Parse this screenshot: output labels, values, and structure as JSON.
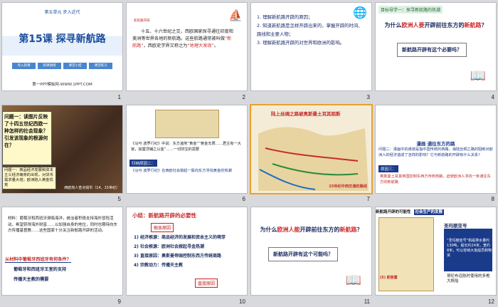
{
  "slides": {
    "s1": {
      "number": "1",
      "unit": "第五单元  步入近代",
      "title": "第15课 探寻新航路",
      "buttons": [
        "导入新课",
        "新课讲授",
        "课堂小结",
        "课堂练习"
      ],
      "footer": "第一PPT模板网-WWW.1PPT.COM"
    },
    "s2": {
      "number": "2",
      "tag": "新航路开辟",
      "body_a": "十五、十六世纪之交，西欧国家探寻通往印度和美洲等世界各地的新航路。这些航路通常被叫做",
      "body_red1": "“新航路”",
      "body_b": "，西欧史学界又称之为",
      "body_red2": "“地理大发现”",
      "body_c": "。"
    },
    "s3": {
      "number": "3",
      "items": [
        "1. 理解新航路开辟的原因；",
        "2. 知道新航路是怎样开辟出来的，掌握开辟的时间、路线和主要人物；",
        "3. 理解新航路开辟的对世界和欧洲的影响。"
      ]
    },
    "s4": {
      "number": "4",
      "goal": "目标导学一：探寻新航路的热潮",
      "q_a": "为什么",
      "q_red": "欧洲人要",
      "q_b": "开辟前往东方的",
      "q_red2": "新航路",
      "q_c": "？",
      "box": "新航路开辟有这个必要吗？"
    },
    "s5": {
      "number": "5",
      "question": "问题一：读图片反映了十四五世纪西欧一种怎样的社会现象？引发该现象的根源何在？",
      "summary": "问题一：商品经济发展和资本主义经济萌芽的出现，对货币需求量大增；欧洲陷入黄金饥荒",
      "caption": "西欧商人查点钱币（14、15世纪）"
    },
    "s6": {
      "number": "6",
      "quote": "《马可·波罗行纪》中说：东方遍地“黄金”“黄金无限……君主有一大宫，其屋顶铺之以金”……一切财宝的需要",
      "heading": "归纳原因二：",
      "quote2": "《马可·波罗行纪》在西欧社会掀起一股向东方寻找黄金的热潮"
    },
    "s7": {
      "number": "7",
      "map_title": "陆上丝绸之路被奥斯曼土耳其阻断",
      "map_foot": "15世纪中西交通的路线"
    },
    "s8": {
      "number": "8",
      "title": "漫画  通往东方的路",
      "q": "问题二：漫画中的通道是指中国传统的商路，海陆丝绸之路的阻断对欧洲人的经济造成了怎样的影响？它与新航路的开辟有什么关系？",
      "reason_label": "原因三：",
      "reason": "奥斯曼土耳其帝国控制东西方传统商路，迫使欧洲人寻找一条通往东方的新航路"
    },
    "s9": {
      "number": "9",
      "material": "材料：葡萄牙和西班牙濒临海洋，统治者积极支持海外冒险活动，希望获得海外财富……以加强自身的地位，同时也期待向东方传播基督教……这些国家十分关注新航路开辟的活动。",
      "sub": "从材料中葡萄牙西班牙有何条件？",
      "r1": "葡萄牙和西班牙王室的支持",
      "r2": "传播天主教的需要"
    },
    "s10": {
      "number": "10",
      "title": "小结：新航路开辟的必要性",
      "root": "根本原因",
      "items": [
        "1) 经济根源：商品经济的发展和资本主义的萌芽",
        "2) 社会根源：欧洲社会掀起寻金热潮",
        "3) 直接原因：奥斯曼帝国控制东西方传统商路",
        "4) 宗教动力：传播天主教"
      ],
      "direct": "直接原因"
    },
    "s11": {
      "number": "11",
      "q_a": "为什么",
      "q_red": "欧洲人能",
      "q_b": "开辟前往东方的",
      "q_red2": "新航路",
      "q_c": "？",
      "box": "新航路开辟有这个可能吗？"
    },
    "s12": {
      "number": "12",
      "header": "新航路开辟的可能性",
      "tag": "社会生产的发展",
      "caption1": "圣玛丽亚号",
      "panel_text": "“圣玛丽亚号”帆船排水量约130吨，船长约24米，宽约8米，可以容纳大批船员和物资",
      "panel_text2": "哥伦布远航时使用的多桅大帆船",
      "small": "(5)  舵装置"
    }
  }
}
